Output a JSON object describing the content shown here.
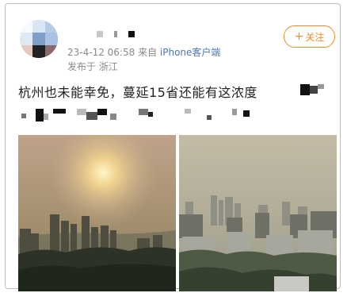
{
  "post": {
    "timestamp": "23-4-12 06:58",
    "source_prefix": "来自",
    "source_client": "iPhone客户端",
    "location": "发布于 浙江",
    "text": "杭州也未能幸免，蔓延15省还能有这浓度",
    "follow_label": "关注",
    "follow_plus": "+"
  },
  "colors": {
    "accent_follow": "#f08a24",
    "client_link": "#4a78c2",
    "meta_gray": "#8a8a8a"
  },
  "images": [
    {
      "icon": "hazy-sunrise-city-photo"
    },
    {
      "icon": "hazy-city-skyline-photo"
    }
  ]
}
